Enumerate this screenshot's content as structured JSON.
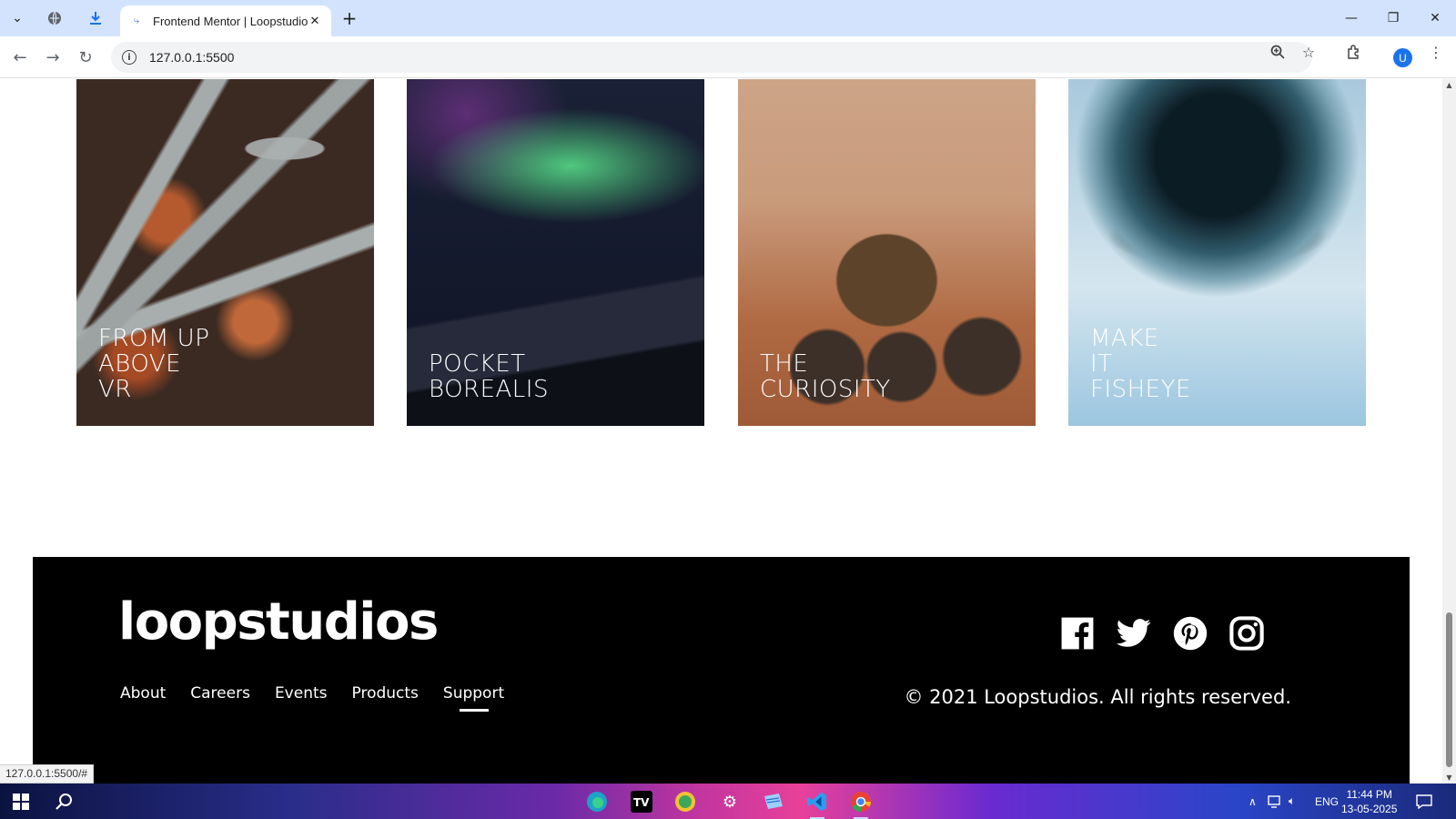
{
  "browser": {
    "tab_title": "Frontend Mentor | Loopstudios",
    "url": "127.0.0.1:5500",
    "status_url": "127.0.0.1:5500/#",
    "profile_initial": "U"
  },
  "page": {
    "cards": [
      {
        "lines": [
          "From up",
          "above",
          "VR"
        ]
      },
      {
        "lines": [
          "Pocket",
          "borealis"
        ]
      },
      {
        "lines": [
          "The",
          "curiosity"
        ]
      },
      {
        "lines": [
          "Make",
          "it",
          "fisheye"
        ]
      }
    ],
    "footer": {
      "logo": "loopstudios",
      "nav": [
        {
          "label": "About",
          "active": false
        },
        {
          "label": "Careers",
          "active": false
        },
        {
          "label": "Events",
          "active": false
        },
        {
          "label": "Products",
          "active": false
        },
        {
          "label": "Support",
          "active": true
        }
      ],
      "social": [
        "facebook-icon",
        "twitter-icon",
        "pinterest-icon",
        "instagram-icon"
      ],
      "copyright": "© 2021 Loopstudios. All rights reserved."
    }
  },
  "taskbar": {
    "language": "ENG",
    "time": "11:44 PM",
    "date": "13-05-2025"
  },
  "colors": {
    "footer_bg": "#000000",
    "tabbar_bg": "#d3e3fd"
  }
}
